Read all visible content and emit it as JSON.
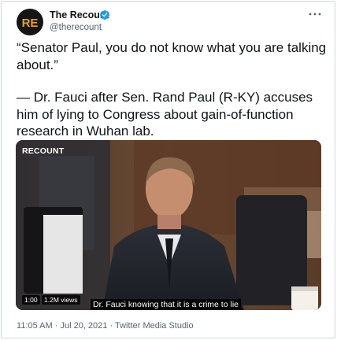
{
  "author": {
    "name": "The Recount",
    "handle": "@therecount",
    "avatar_text": "RE"
  },
  "tweet": {
    "quote": "“Senator Paul, you do not know what you are talking about.”",
    "context": "— Dr. Fauci after Sen. Rand Paul (R-KY) accuses him of lying to Congress about gain-of-function research in Wuhan lab."
  },
  "media": {
    "channel_logo": "RECOUNT",
    "time": "1:00",
    "views": "1.2M views",
    "subtitle": "Dr. Fauci knowing that it is a crime to lie"
  },
  "meta": {
    "time": "11:05 AM",
    "date": "Jul 20, 2021",
    "source": "Twitter Media Studio",
    "separator": "·"
  },
  "icons": {
    "verified": "verified-badge-icon",
    "more": "more-options-icon",
    "play": "video-player"
  },
  "colors": {
    "verified": "#1d9bf0",
    "text": "#0f1419",
    "secondary": "#536471",
    "border": "#cfd9de"
  }
}
